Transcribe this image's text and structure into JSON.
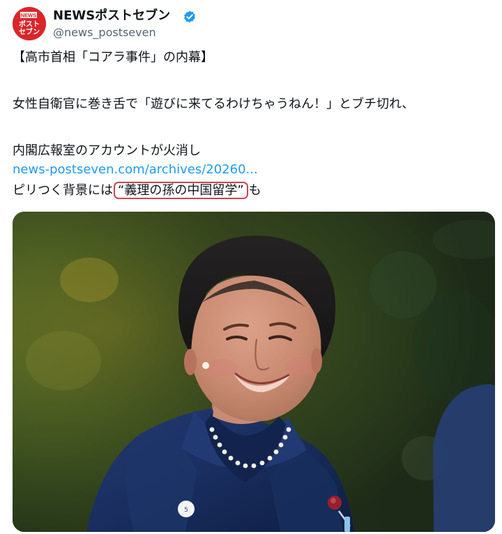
{
  "account": {
    "name": "NEWSポストセブン",
    "handle": "@news_postseven",
    "avatar_text_top": "NEWS",
    "avatar_text_bottom": "ポスト\nセブン"
  },
  "tweet": {
    "line1": "【高市首相「コアラ事件」の内幕】",
    "line2": "女性自衛官に巻き舌で「遊びに来てるわけちゃうねん！」とブチ切れ、",
    "line3": "内閣広報室のアカウントが火消し",
    "link": "news-postseven.com/archives/20260...",
    "line5_prefix": "ピリつく背景には",
    "line5_highlight": "“義理の孫の中国留学”",
    "line5_suffix": "も"
  },
  "colors": {
    "brand_red": "#d9262a",
    "verified_blue": "#1d9bf0",
    "link_blue": "#1d9bf0",
    "highlight_border": "#c84551",
    "text": "#0f1419",
    "muted": "#536471"
  }
}
